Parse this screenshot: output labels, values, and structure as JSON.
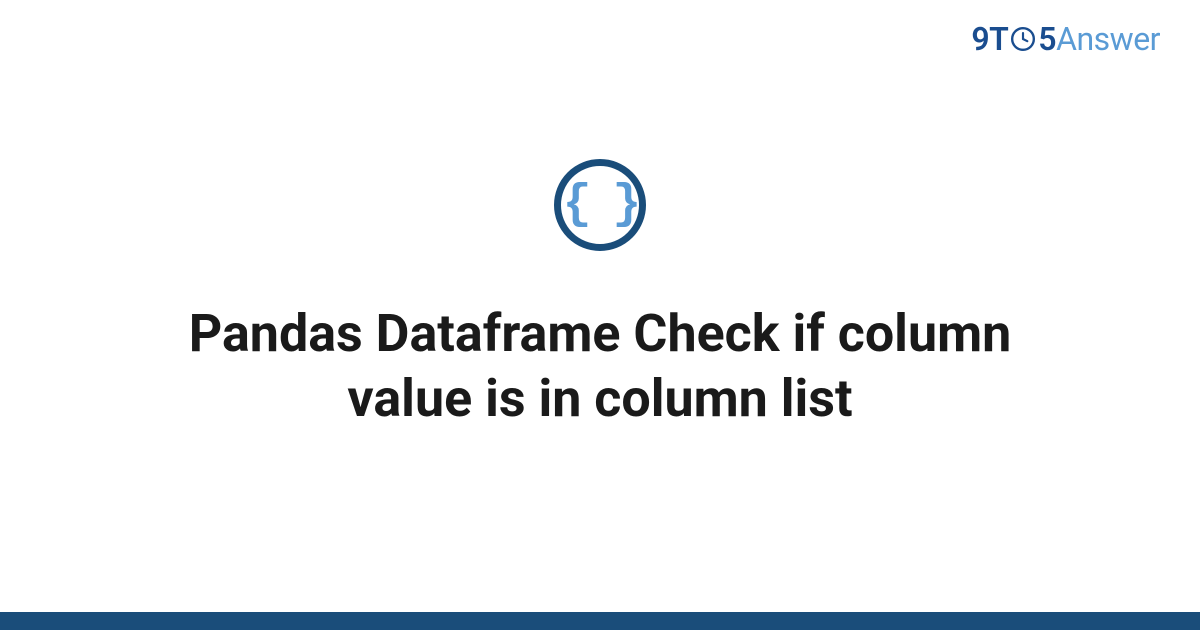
{
  "logo": {
    "part1": "9T",
    "part2": "5",
    "part3": "Answer"
  },
  "icon": {
    "symbol": "{ }"
  },
  "title": "Pandas Dataframe Check if column value is in column list"
}
